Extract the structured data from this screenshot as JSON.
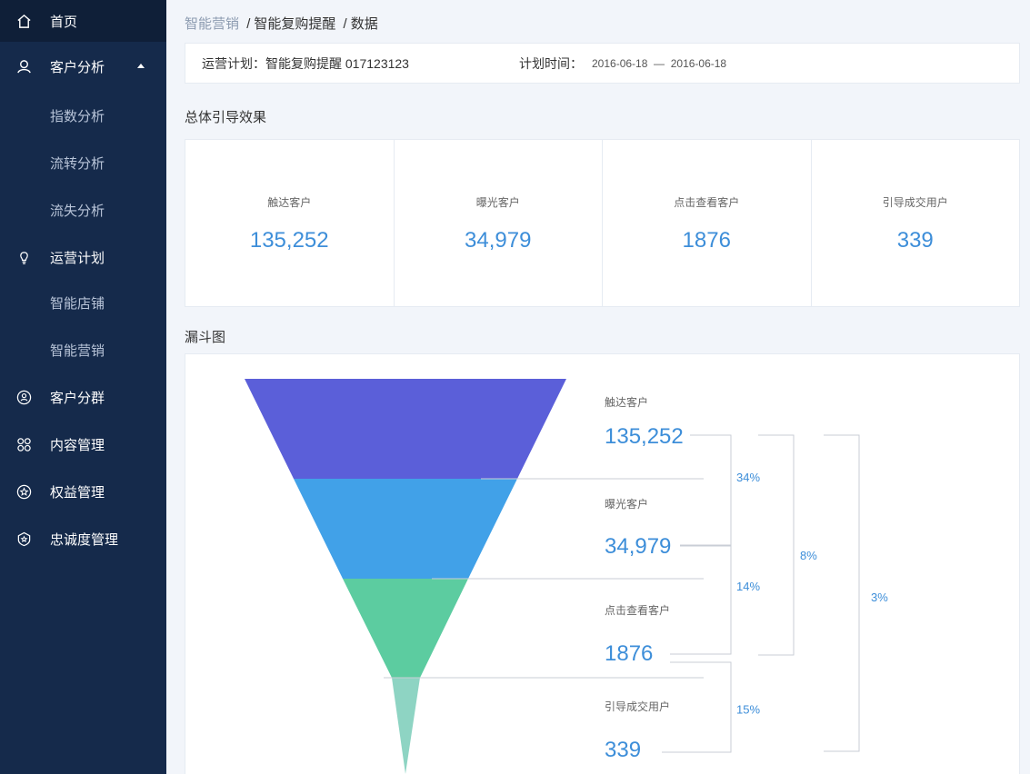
{
  "sidebar": {
    "home": "首页",
    "customer_analysis": "客户分析",
    "index_analysis": "指数分析",
    "flow_analysis": "流转分析",
    "churn_analysis": "流失分析",
    "operation_plan": "运营计划",
    "smart_store": "智能店铺",
    "smart_marketing": "智能营销",
    "customer_group": "客户分群",
    "content_mgmt": "内容管理",
    "benefit_mgmt": "权益管理",
    "loyalty_mgmt": "忠诚度管理"
  },
  "breadcrumb": {
    "link": "智能营销",
    "sep1": "/",
    "current1": "智能复购提醒",
    "sep2": "/",
    "current2": "数据"
  },
  "plan": {
    "label": "运营计划：智能复购提醒 017123123",
    "time_label": "计划时间：",
    "time_value": "2016-06-18  —  2016-06-18"
  },
  "overview": {
    "title": "总体引导效果",
    "stats": [
      {
        "label": "触达客户",
        "value": "135,252"
      },
      {
        "label": "曝光客户",
        "value": "34,979"
      },
      {
        "label": "点击查看客户",
        "value": "1876"
      },
      {
        "label": "引导成交用户",
        "value": "339"
      }
    ]
  },
  "funnel": {
    "title": "漏斗图",
    "stages": [
      {
        "label": "触达客户",
        "value": "135,252",
        "color": "#5b5fd9"
      },
      {
        "label": "曝光客户",
        "value": "34,979",
        "color": "#41a1e8"
      },
      {
        "label": "点击查看客户",
        "value": "1876",
        "color": "#5ccca0"
      },
      {
        "label": "引导成交用户",
        "value": "339",
        "color": "#8ed4c3"
      }
    ],
    "step_rates": [
      "34%",
      "14%",
      "15%"
    ],
    "span_rates": [
      "8%",
      "3%"
    ],
    "accent_text": "#3d8ed9",
    "line_color": "#c9ced6"
  }
}
